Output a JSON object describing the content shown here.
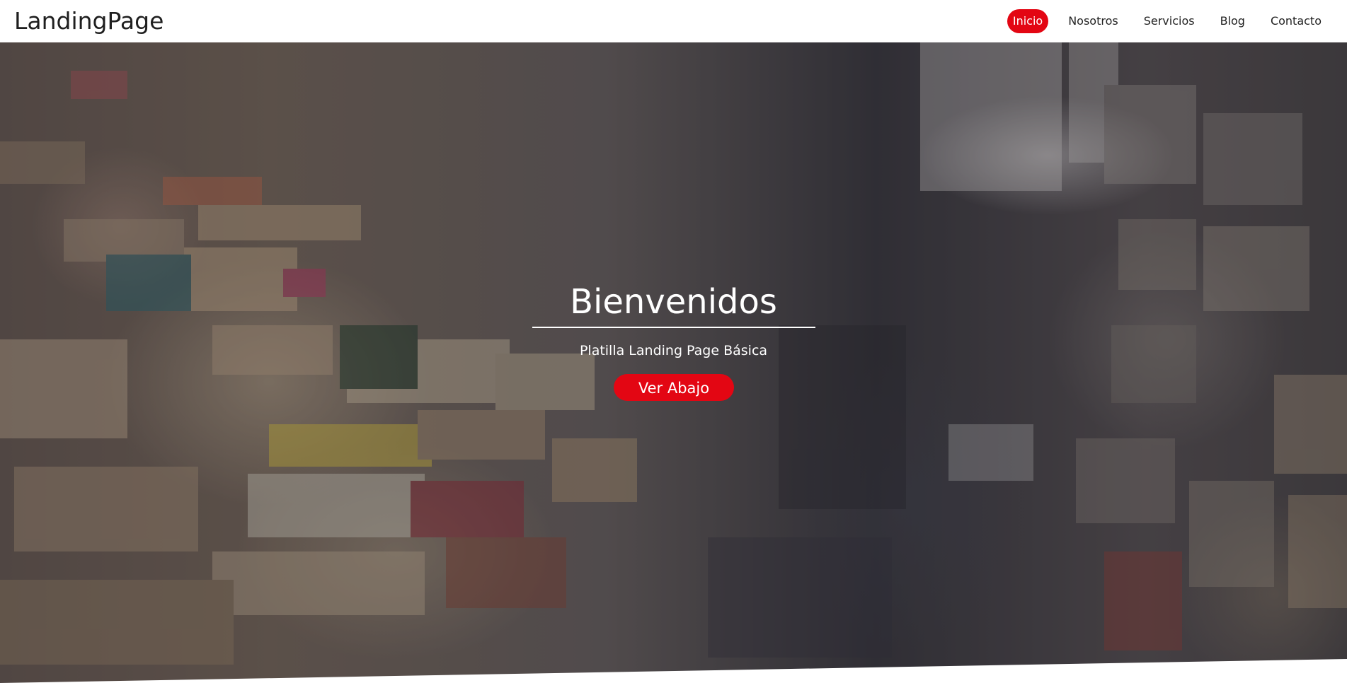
{
  "brand": {
    "name": "LandingPage"
  },
  "nav": {
    "items": [
      {
        "label": "Inicio",
        "active": true
      },
      {
        "label": "Nosotros",
        "active": false
      },
      {
        "label": "Servicios",
        "active": false
      },
      {
        "label": "Blog",
        "active": false
      },
      {
        "label": "Contacto",
        "active": false
      }
    ]
  },
  "hero": {
    "title": "Bienvenidos",
    "subtitle": "Platilla Landing Page Básica",
    "cta_label": "Ver Abajo",
    "background": "library-books-photo"
  },
  "colors": {
    "accent": "#e30613",
    "nav_background": "#ffffff",
    "text_light": "#ffffff",
    "text_dark": "#222222"
  }
}
